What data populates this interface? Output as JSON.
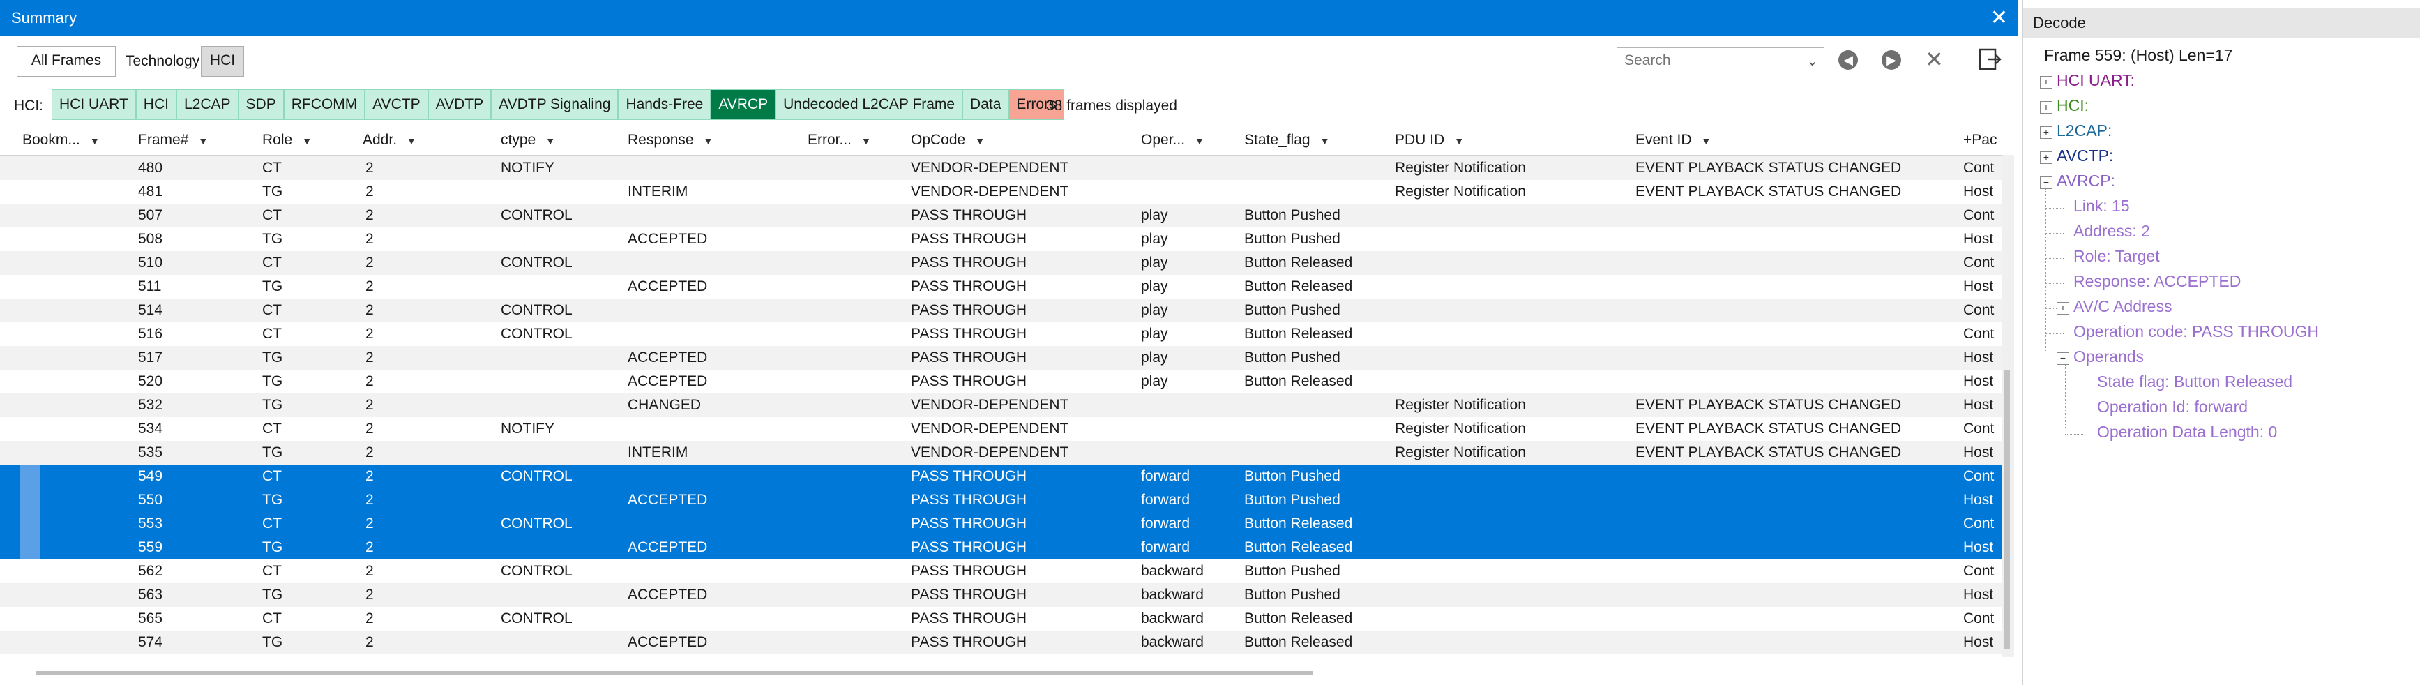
{
  "summary": {
    "title": "Summary",
    "all_frames_label": "All Frames",
    "technology_label": "Technology:",
    "technology_value": "HCI",
    "search_placeholder": "Search",
    "hci_label": "HCI:",
    "frames_displayed": "38 frames displayed",
    "chips": [
      {
        "label": "HCI UART",
        "bg": "#c6efdf"
      },
      {
        "label": "HCI",
        "bg": "#c6efdf"
      },
      {
        "label": "L2CAP",
        "bg": "#c6efdf"
      },
      {
        "label": "SDP",
        "bg": "#c6efdf"
      },
      {
        "label": "RFCOMM",
        "bg": "#c6efdf"
      },
      {
        "label": "AVCTP",
        "bg": "#c6efdf"
      },
      {
        "label": "AVDTP",
        "bg": "#c6efdf"
      },
      {
        "label": "AVDTP Signaling",
        "bg": "#c6efdf"
      },
      {
        "label": "Hands-Free",
        "bg": "#c6efdf"
      },
      {
        "label": "AVRCP",
        "bg": "#007a47",
        "fg": "#ffffff"
      },
      {
        "label": "Undecoded L2CAP Frame",
        "bg": "#c6efdf"
      },
      {
        "label": "Data",
        "bg": "#c6efdf"
      },
      {
        "label": "Errors",
        "bg": "#f7a494"
      }
    ],
    "columns": [
      "Bookm...",
      "Frame#",
      "Role",
      "Addr.",
      "ctype",
      "Response",
      "Error...",
      "OpCode",
      "Oper...",
      "State_flag",
      "PDU ID",
      "Event ID",
      "+Pac"
    ],
    "rows": [
      {
        "frame": "480",
        "role": "CT",
        "addr": "2",
        "ctype": "NOTIFY",
        "response": "",
        "opcode": "VENDOR-DEPENDENT",
        "oper": "",
        "state": "",
        "pdu": "Register Notification",
        "event": "EVENT PLAYBACK STATUS CHANGED",
        "pac": "Cont",
        "selected": false
      },
      {
        "frame": "481",
        "role": "TG",
        "addr": "2",
        "ctype": "",
        "response": "INTERIM",
        "opcode": "VENDOR-DEPENDENT",
        "oper": "",
        "state": "",
        "pdu": "Register Notification",
        "event": "EVENT PLAYBACK STATUS CHANGED",
        "pac": "Host",
        "selected": false
      },
      {
        "frame": "507",
        "role": "CT",
        "addr": "2",
        "ctype": "CONTROL",
        "response": "",
        "opcode": "PASS THROUGH",
        "oper": "play",
        "state": "Button Pushed",
        "pdu": "",
        "event": "",
        "pac": "Cont",
        "selected": false
      },
      {
        "frame": "508",
        "role": "TG",
        "addr": "2",
        "ctype": "",
        "response": "ACCEPTED",
        "opcode": "PASS THROUGH",
        "oper": "play",
        "state": "Button Pushed",
        "pdu": "",
        "event": "",
        "pac": "Host",
        "selected": false
      },
      {
        "frame": "510",
        "role": "CT",
        "addr": "2",
        "ctype": "CONTROL",
        "response": "",
        "opcode": "PASS THROUGH",
        "oper": "play",
        "state": "Button Released",
        "pdu": "",
        "event": "",
        "pac": "Cont",
        "selected": false
      },
      {
        "frame": "511",
        "role": "TG",
        "addr": "2",
        "ctype": "",
        "response": "ACCEPTED",
        "opcode": "PASS THROUGH",
        "oper": "play",
        "state": "Button Released",
        "pdu": "",
        "event": "",
        "pac": "Host",
        "selected": false
      },
      {
        "frame": "514",
        "role": "CT",
        "addr": "2",
        "ctype": "CONTROL",
        "response": "",
        "opcode": "PASS THROUGH",
        "oper": "play",
        "state": "Button Pushed",
        "pdu": "",
        "event": "",
        "pac": "Cont",
        "selected": false
      },
      {
        "frame": "516",
        "role": "CT",
        "addr": "2",
        "ctype": "CONTROL",
        "response": "",
        "opcode": "PASS THROUGH",
        "oper": "play",
        "state": "Button Released",
        "pdu": "",
        "event": "",
        "pac": "Cont",
        "selected": false
      },
      {
        "frame": "517",
        "role": "TG",
        "addr": "2",
        "ctype": "",
        "response": "ACCEPTED",
        "opcode": "PASS THROUGH",
        "oper": "play",
        "state": "Button Pushed",
        "pdu": "",
        "event": "",
        "pac": "Host",
        "selected": false
      },
      {
        "frame": "520",
        "role": "TG",
        "addr": "2",
        "ctype": "",
        "response": "ACCEPTED",
        "opcode": "PASS THROUGH",
        "oper": "play",
        "state": "Button Released",
        "pdu": "",
        "event": "",
        "pac": "Host",
        "selected": false
      },
      {
        "frame": "532",
        "role": "TG",
        "addr": "2",
        "ctype": "",
        "response": "CHANGED",
        "opcode": "VENDOR-DEPENDENT",
        "oper": "",
        "state": "",
        "pdu": "Register Notification",
        "event": "EVENT PLAYBACK STATUS CHANGED",
        "pac": "Host",
        "selected": false
      },
      {
        "frame": "534",
        "role": "CT",
        "addr": "2",
        "ctype": "NOTIFY",
        "response": "",
        "opcode": "VENDOR-DEPENDENT",
        "oper": "",
        "state": "",
        "pdu": "Register Notification",
        "event": "EVENT PLAYBACK STATUS CHANGED",
        "pac": "Cont",
        "selected": false
      },
      {
        "frame": "535",
        "role": "TG",
        "addr": "2",
        "ctype": "",
        "response": "INTERIM",
        "opcode": "VENDOR-DEPENDENT",
        "oper": "",
        "state": "",
        "pdu": "Register Notification",
        "event": "EVENT PLAYBACK STATUS CHANGED",
        "pac": "Host",
        "selected": false
      },
      {
        "frame": "549",
        "role": "CT",
        "addr": "2",
        "ctype": "CONTROL",
        "response": "",
        "opcode": "PASS THROUGH",
        "oper": "forward",
        "state": "Button Pushed",
        "pdu": "",
        "event": "",
        "pac": "Cont",
        "selected": true
      },
      {
        "frame": "550",
        "role": "TG",
        "addr": "2",
        "ctype": "",
        "response": "ACCEPTED",
        "opcode": "PASS THROUGH",
        "oper": "forward",
        "state": "Button Pushed",
        "pdu": "",
        "event": "",
        "pac": "Host",
        "selected": true
      },
      {
        "frame": "553",
        "role": "CT",
        "addr": "2",
        "ctype": "CONTROL",
        "response": "",
        "opcode": "PASS THROUGH",
        "oper": "forward",
        "state": "Button Released",
        "pdu": "",
        "event": "",
        "pac": "Cont",
        "selected": true
      },
      {
        "frame": "559",
        "role": "TG",
        "addr": "2",
        "ctype": "",
        "response": "ACCEPTED",
        "opcode": "PASS THROUGH",
        "oper": "forward",
        "state": "Button Released",
        "pdu": "",
        "event": "",
        "pac": "Host",
        "selected": true
      },
      {
        "frame": "562",
        "role": "CT",
        "addr": "2",
        "ctype": "CONTROL",
        "response": "",
        "opcode": "PASS THROUGH",
        "oper": "backward",
        "state": "Button Pushed",
        "pdu": "",
        "event": "",
        "pac": "Cont",
        "selected": false
      },
      {
        "frame": "563",
        "role": "TG",
        "addr": "2",
        "ctype": "",
        "response": "ACCEPTED",
        "opcode": "PASS THROUGH",
        "oper": "backward",
        "state": "Button Pushed",
        "pdu": "",
        "event": "",
        "pac": "Host",
        "selected": false
      },
      {
        "frame": "565",
        "role": "CT",
        "addr": "2",
        "ctype": "CONTROL",
        "response": "",
        "opcode": "PASS THROUGH",
        "oper": "backward",
        "state": "Button Released",
        "pdu": "",
        "event": "",
        "pac": "Cont",
        "selected": false
      },
      {
        "frame": "574",
        "role": "TG",
        "addr": "2",
        "ctype": "",
        "response": "ACCEPTED",
        "opcode": "PASS THROUGH",
        "oper": "backward",
        "state": "Button Released",
        "pdu": "",
        "event": "",
        "pac": "Host",
        "selected": false
      }
    ]
  },
  "decode": {
    "title": "Decode",
    "frame_line": "Frame 559: (Host) Len=17",
    "tree": [
      {
        "label": "HCI UART:",
        "color": "#8a1d8a"
      },
      {
        "label": "HCI:",
        "color": "#3d8a1d"
      },
      {
        "label": "L2CAP:",
        "color": "#1d6a9a"
      },
      {
        "label": "AVCTP:",
        "color": "#1a2f8a"
      },
      {
        "label": "AVRCP:",
        "color": "#8a62c8"
      }
    ],
    "avrcp_children": [
      "Link: 15",
      "Address: 2",
      "Role: Target",
      "Response: ACCEPTED",
      "AV/C Address",
      "Operation code: PASS THROUGH",
      "Operands"
    ],
    "operands_children": [
      "State flag: Button Released",
      "Operation Id: forward",
      "Operation Data Length: 0"
    ],
    "child_color": "#9a6fd0"
  }
}
